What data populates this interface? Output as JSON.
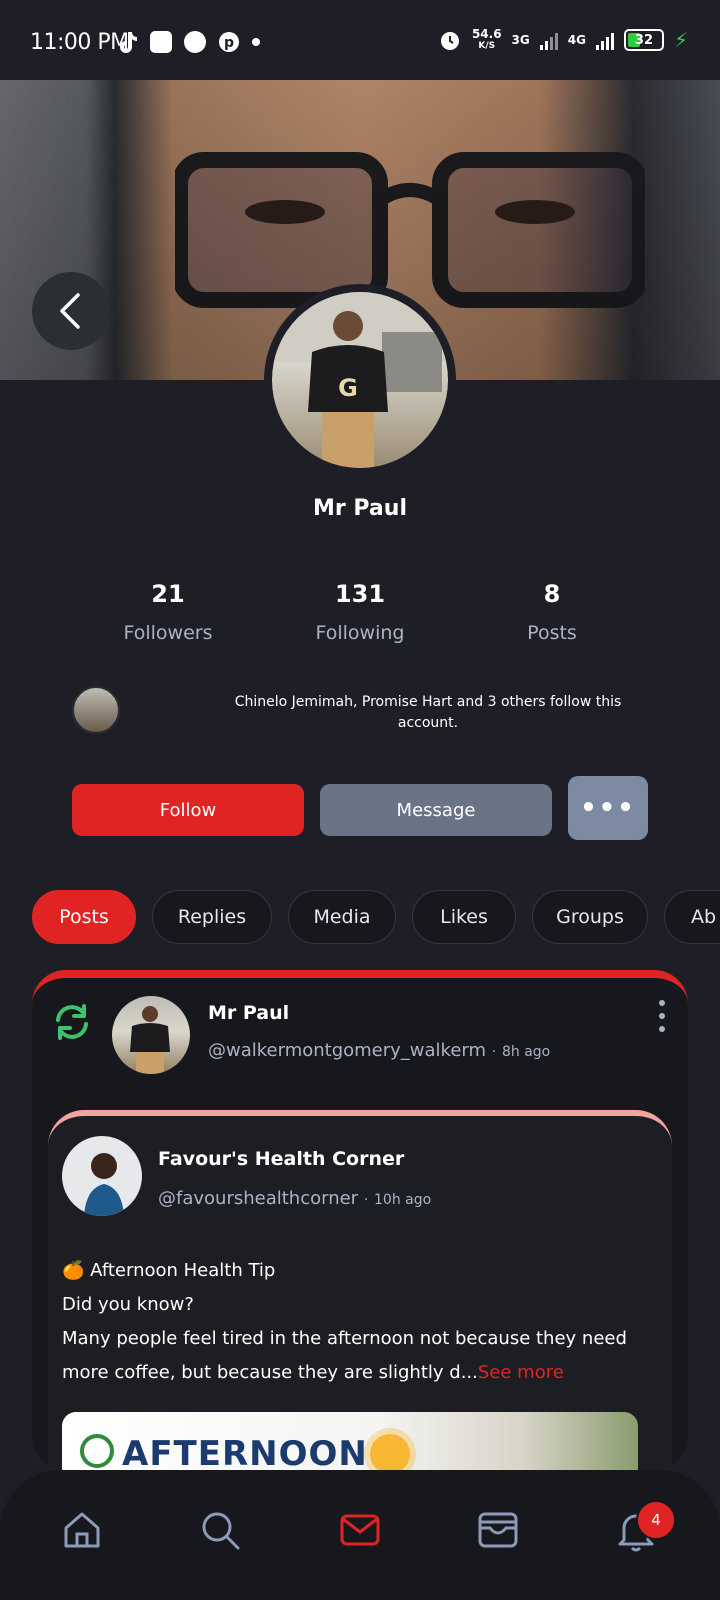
{
  "status_bar": {
    "time": "11:00 PM",
    "net_speed": "54.6",
    "net_speed_unit": "K/S",
    "net_3g": "3G",
    "net_4g": "4G",
    "battery": "32"
  },
  "profile": {
    "name": "Mr Paul",
    "stats": [
      {
        "value": "21",
        "label": "Followers"
      },
      {
        "value": "131",
        "label": "Following"
      },
      {
        "value": "8",
        "label": "Posts"
      }
    ],
    "mutual_followers_text": "Chinelo Jemimah, Promise Hart and 3 others follow this account."
  },
  "actions": {
    "follow_label": "Follow",
    "message_label": "Message",
    "more_label": "•••"
  },
  "tabs": [
    {
      "label": "Posts",
      "active": true
    },
    {
      "label": "Replies"
    },
    {
      "label": "Media"
    },
    {
      "label": "Likes"
    },
    {
      "label": "Groups"
    },
    {
      "label": "Ab"
    }
  ],
  "post": {
    "author_name": "Mr Paul",
    "author_handle": "@walkermontgomery_walkerm",
    "separator": "·",
    "time": "8h ago",
    "shared": {
      "author_name": "Favour's Health Corner",
      "author_handle": "@favourshealthcorner",
      "time": "10h ago",
      "emoji": "🍊",
      "line1": "Afternoon Health Tip",
      "line2": "Did you know?",
      "line3": "Many people feel tired in the afternoon not because they need more coffee, but because they are slightly d...",
      "see_more": "See more",
      "image_text": "AFTERNOON"
    }
  },
  "bottom_nav": {
    "items": [
      "home-icon",
      "search-icon",
      "mail-icon",
      "wallet-icon",
      "bell-icon"
    ],
    "active": "mail-icon",
    "notification_count": "4"
  },
  "colors": {
    "accent": "#e02424",
    "background": "#1e1f26",
    "card": "#17181d",
    "muted_text": "#aab3c5",
    "message_button": "#6b7487"
  }
}
